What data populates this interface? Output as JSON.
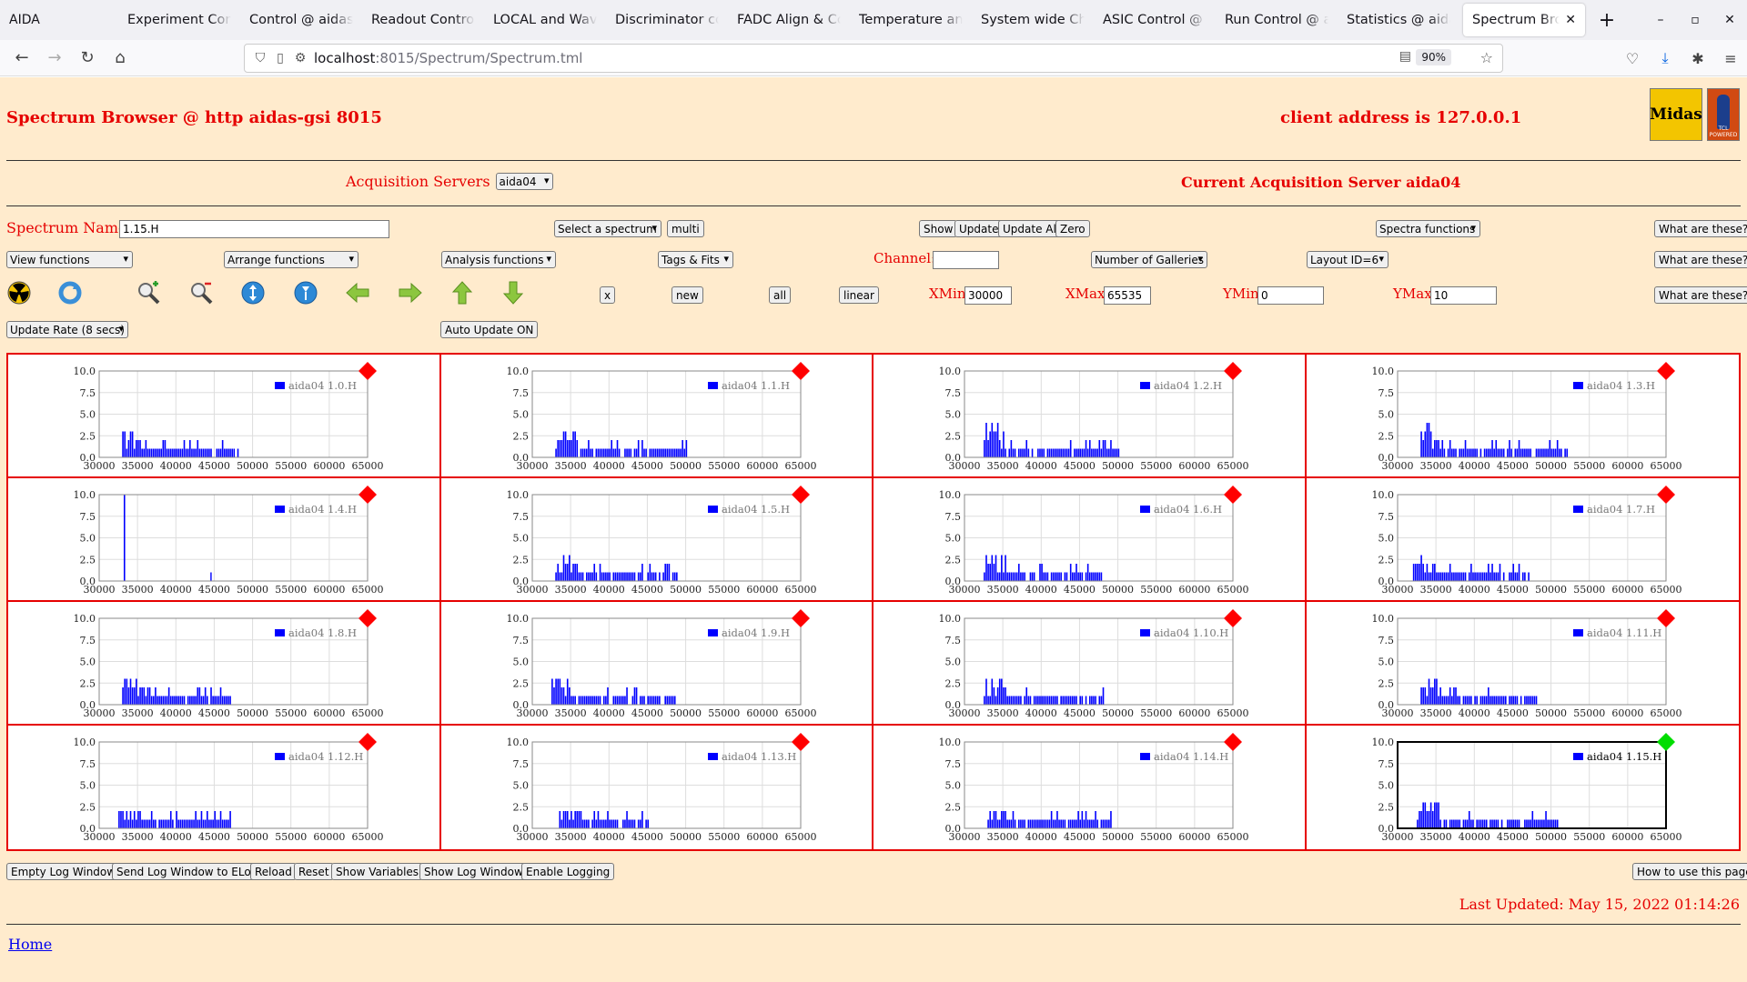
{
  "browser": {
    "app_label": "AIDA",
    "tabs": [
      "Experiment Control",
      "Control @ aidas-gsi",
      "Readout Control @",
      "LOCAL and Waveform",
      "Discriminator control",
      "FADC Align & Control",
      "Temperature and",
      "System wide Checks",
      "ASIC Control @ aidas",
      "Run Control @ aidas",
      "Statistics @ aidas",
      "Spectrum Browser"
    ],
    "url_host": "localhost",
    "url_path": ":8015/Spectrum/Spectrum.tml",
    "zoom": "90%"
  },
  "page": {
    "title": "Spectrum Browser @ http aidas-gsi 8015",
    "client_address": "client address is 127.0.0.1",
    "logo_text": "Midas",
    "logo2_text": "TCL POWERED",
    "acq_label": "Acquisition Servers",
    "acq_value": "aida04",
    "current_server": "Current Acquisition Server aida04",
    "spectrum_name_label": "Spectrum Name:",
    "spectrum_name_value": "1.15.H",
    "select_spectrum": "Select a spectrum",
    "multi": "multi",
    "show": "Show",
    "update": "Update",
    "update_all": "Update All",
    "zero": "Zero",
    "spectra_functions": "Spectra functions",
    "what": "What are these?",
    "view_functions": "View functions",
    "arrange_functions": "Arrange functions",
    "analysis_functions": "Analysis functions",
    "tags_fits": "Tags & Fits",
    "channel_label": "Channel:",
    "channel_value": "",
    "galleries": "Number of Galleries",
    "layout": "Layout ID=6",
    "x_btn": "x",
    "new_btn": "new",
    "all_btn": "all",
    "linear_btn": "linear",
    "xmin_label": "XMin",
    "xmin_value": "30000",
    "xmax_label": "XMax",
    "xmax_value": "65535",
    "ymin_label": "YMin",
    "ymin_value": "0",
    "ymax_label": "YMax",
    "ymax_value": "10",
    "update_rate": "Update Rate (8 secs)",
    "auto_update": "Auto Update ON",
    "bottom_buttons": [
      "Empty Log Window",
      "Send Log Window to ELog",
      "Reload",
      "Reset",
      "Show Variables",
      "Show Log Window",
      "Enable Logging"
    ],
    "how_to": "How to use this page",
    "last_updated": "Last Updated: May 15, 2022 01:14:26",
    "home": "Home"
  },
  "colors": {
    "accent_red": "#e60000",
    "page_bg": "#ffebcd",
    "series_blue": "#0000ff",
    "marker_inactive": "#ff0000",
    "marker_active": "#00dd00"
  },
  "chart_data": [
    {
      "type": "bar",
      "legend": "aida04 1.0.H",
      "xlim": [
        30000,
        65000
      ],
      "ylim": [
        0,
        10
      ],
      "xticks": [
        30000,
        35000,
        40000,
        45000,
        50000,
        55000,
        60000,
        65000
      ],
      "yticks": [
        "0.0",
        "2.5",
        "5.0",
        "7.5",
        "10.0"
      ],
      "peak_x": 34000,
      "peak_y": 3,
      "tail_end": 48000,
      "selected": false
    },
    {
      "type": "bar",
      "legend": "aida04 1.1.H",
      "xlim": [
        30000,
        65000
      ],
      "ylim": [
        0,
        10
      ],
      "xticks": [
        30000,
        35000,
        40000,
        45000,
        50000,
        55000,
        60000,
        65000
      ],
      "yticks": [
        "0.0",
        "2.5",
        "5.0",
        "7.5",
        "10.0"
      ],
      "peak_x": 34000,
      "peak_y": 3,
      "tail_end": 50000,
      "selected": false
    },
    {
      "type": "bar",
      "legend": "aida04 1.2.H",
      "xlim": [
        30000,
        65000
      ],
      "ylim": [
        0,
        10
      ],
      "xticks": [
        30000,
        35000,
        40000,
        45000,
        50000,
        55000,
        60000,
        65000
      ],
      "yticks": [
        "0.0",
        "2.5",
        "5.0",
        "7.5",
        "10.0"
      ],
      "peak_x": 33500,
      "peak_y": 4,
      "tail_end": 50000,
      "selected": false
    },
    {
      "type": "bar",
      "legend": "aida04 1.3.H",
      "xlim": [
        30000,
        65000
      ],
      "ylim": [
        0,
        10
      ],
      "xticks": [
        30000,
        35000,
        40000,
        45000,
        50000,
        55000,
        60000,
        65000
      ],
      "yticks": [
        "0.0",
        "2.5",
        "5.0",
        "7.5",
        "10.0"
      ],
      "peak_x": 34000,
      "peak_y": 4,
      "tail_end": 52000,
      "selected": false
    },
    {
      "type": "bar",
      "legend": "aida04 1.4.H",
      "xlim": [
        30000,
        65000
      ],
      "ylim": [
        0,
        10
      ],
      "xticks": [
        30000,
        35000,
        40000,
        45000,
        50000,
        55000,
        60000,
        65000
      ],
      "yticks": [
        "0.0",
        "2.5",
        "5.0",
        "7.5",
        "10.0"
      ],
      "peak_x": 33200,
      "peak_y": 10,
      "tail_end": 33400,
      "selected": false
    },
    {
      "type": "bar",
      "legend": "aida04 1.5.H",
      "xlim": [
        30000,
        65000
      ],
      "ylim": [
        0,
        10
      ],
      "xticks": [
        30000,
        35000,
        40000,
        45000,
        50000,
        55000,
        60000,
        65000
      ],
      "yticks": [
        "0.0",
        "2.5",
        "5.0",
        "7.5",
        "10.0"
      ],
      "peak_x": 34000,
      "peak_y": 3,
      "tail_end": 49000,
      "selected": false
    },
    {
      "type": "bar",
      "legend": "aida04 1.6.H",
      "xlim": [
        30000,
        65000
      ],
      "ylim": [
        0,
        10
      ],
      "xticks": [
        30000,
        35000,
        40000,
        45000,
        50000,
        55000,
        60000,
        65000
      ],
      "yticks": [
        "0.0",
        "2.5",
        "5.0",
        "7.5",
        "10.0"
      ],
      "peak_x": 33500,
      "peak_y": 3,
      "tail_end": 48000,
      "selected": false
    },
    {
      "type": "bar",
      "legend": "aida04 1.7.H",
      "xlim": [
        30000,
        65000
      ],
      "ylim": [
        0,
        10
      ],
      "xticks": [
        30000,
        35000,
        40000,
        45000,
        50000,
        55000,
        60000,
        65000
      ],
      "yticks": [
        "0.0",
        "2.5",
        "5.0",
        "7.5",
        "10.0"
      ],
      "peak_x": 33000,
      "peak_y": 3,
      "tail_end": 47000,
      "selected": false
    },
    {
      "type": "bar",
      "legend": "aida04 1.8.H",
      "xlim": [
        30000,
        65000
      ],
      "ylim": [
        0,
        10
      ],
      "xticks": [
        30000,
        35000,
        40000,
        45000,
        50000,
        55000,
        60000,
        65000
      ],
      "yticks": [
        "0.0",
        "2.5",
        "5.0",
        "7.5",
        "10.0"
      ],
      "peak_x": 34000,
      "peak_y": 3,
      "tail_end": 47000,
      "selected": false
    },
    {
      "type": "bar",
      "legend": "aida04 1.9.H",
      "xlim": [
        30000,
        65000
      ],
      "ylim": [
        0,
        10
      ],
      "xticks": [
        30000,
        35000,
        40000,
        45000,
        50000,
        55000,
        60000,
        65000
      ],
      "yticks": [
        "0.0",
        "2.5",
        "5.0",
        "7.5",
        "10.0"
      ],
      "peak_x": 33500,
      "peak_y": 3,
      "tail_end": 48500,
      "selected": false
    },
    {
      "type": "bar",
      "legend": "aida04 1.10.H",
      "xlim": [
        30000,
        65000
      ],
      "ylim": [
        0,
        10
      ],
      "xticks": [
        30000,
        35000,
        40000,
        45000,
        50000,
        55000,
        60000,
        65000
      ],
      "yticks": [
        "0.0",
        "2.5",
        "5.0",
        "7.5",
        "10.0"
      ],
      "peak_x": 33500,
      "peak_y": 3,
      "tail_end": 48000,
      "selected": false
    },
    {
      "type": "bar",
      "legend": "aida04 1.11.H",
      "xlim": [
        30000,
        65000
      ],
      "ylim": [
        0,
        10
      ],
      "xticks": [
        30000,
        35000,
        40000,
        45000,
        50000,
        55000,
        60000,
        65000
      ],
      "yticks": [
        "0.0",
        "2.5",
        "5.0",
        "7.5",
        "10.0"
      ],
      "peak_x": 34000,
      "peak_y": 3,
      "tail_end": 48000,
      "selected": false
    },
    {
      "type": "bar",
      "legend": "aida04 1.12.H",
      "xlim": [
        30000,
        65000
      ],
      "ylim": [
        0,
        10
      ],
      "xticks": [
        30000,
        35000,
        40000,
        45000,
        50000,
        55000,
        60000,
        65000
      ],
      "yticks": [
        "0.0",
        "2.5",
        "5.0",
        "7.5",
        "10.0"
      ],
      "peak_x": 33500,
      "peak_y": 2,
      "tail_end": 47000,
      "selected": false
    },
    {
      "type": "bar",
      "legend": "aida04 1.13.H",
      "xlim": [
        30000,
        65000
      ],
      "ylim": [
        0,
        10
      ],
      "xticks": [
        30000,
        35000,
        40000,
        45000,
        50000,
        55000,
        60000,
        65000
      ],
      "yticks": [
        "0.0",
        "2.5",
        "5.0",
        "7.5",
        "10.0"
      ],
      "peak_x": 34500,
      "peak_y": 2,
      "tail_end": 45000,
      "selected": false
    },
    {
      "type": "bar",
      "legend": "aida04 1.14.H",
      "xlim": [
        30000,
        65000
      ],
      "ylim": [
        0,
        10
      ],
      "xticks": [
        30000,
        35000,
        40000,
        45000,
        50000,
        55000,
        60000,
        65000
      ],
      "yticks": [
        "0.0",
        "2.5",
        "5.0",
        "7.5",
        "10.0"
      ],
      "peak_x": 34000,
      "peak_y": 2,
      "tail_end": 49000,
      "selected": false
    },
    {
      "type": "bar",
      "legend": "aida04 1.15.H",
      "xlim": [
        30000,
        65000
      ],
      "ylim": [
        0,
        10
      ],
      "xticks": [
        30000,
        35000,
        40000,
        45000,
        50000,
        55000,
        60000,
        65000
      ],
      "yticks": [
        "0.0",
        "2.5",
        "5.0",
        "7.5",
        "10.0"
      ],
      "peak_x": 33500,
      "peak_y": 3,
      "tail_end": 51000,
      "selected": true
    }
  ]
}
